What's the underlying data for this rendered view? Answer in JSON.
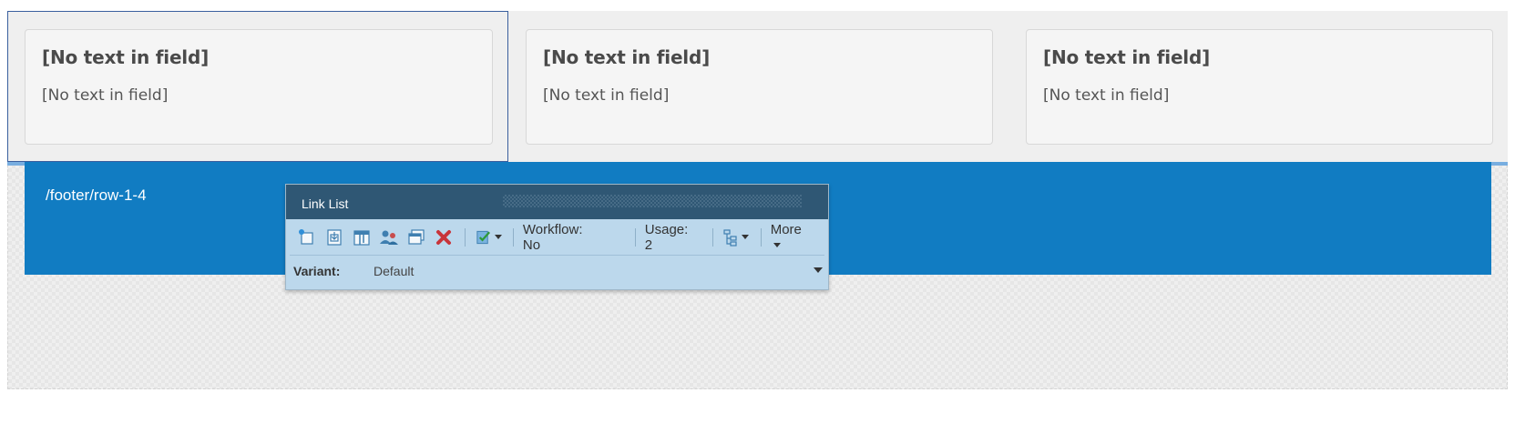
{
  "placeholders": {
    "cards": [
      {
        "title": "[No text in field]",
        "text": "[No text in field]"
      },
      {
        "title": "[No text in field]",
        "text": "[No text in field]"
      },
      {
        "title": "[No text in field]",
        "text": "[No text in field]"
      }
    ]
  },
  "footer": {
    "path": "/footer/row-1-4"
  },
  "chrome": {
    "title": "Link List",
    "toolbar": {
      "icons": [
        "insert-icon",
        "select-parent-icon",
        "edit-datasource-icon",
        "personalize-icon",
        "rendering-properties-icon",
        "delete-icon",
        "test-icon"
      ],
      "workflow": "Workflow: No",
      "usage": "Usage: 2",
      "more": "More"
    },
    "variant": {
      "label": "Variant:",
      "value": "Default"
    }
  }
}
